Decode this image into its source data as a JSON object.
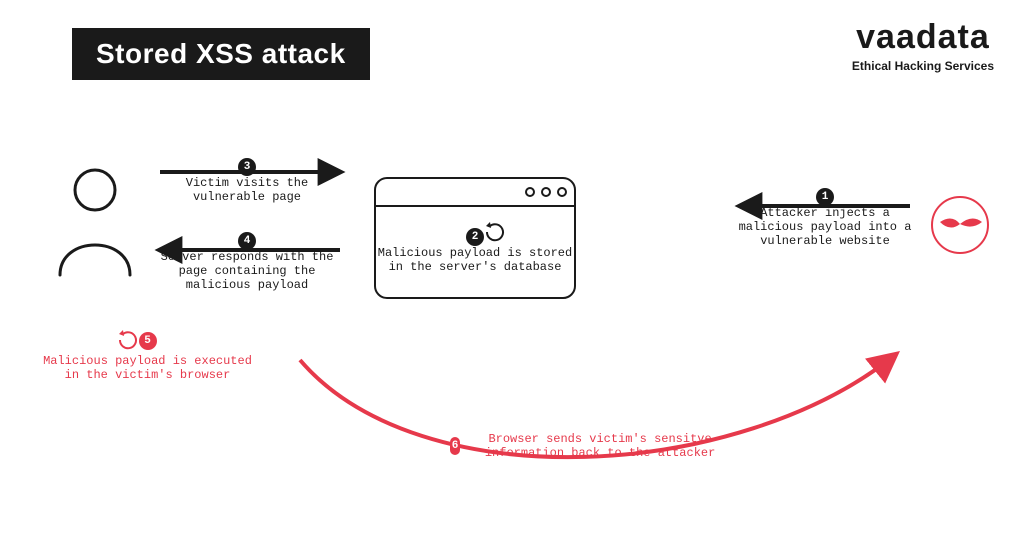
{
  "title": "Stored XSS attack",
  "brand": {
    "name": "vaadata",
    "tagline": "Ethical Hacking Services"
  },
  "steps": {
    "s1": {
      "num": "1",
      "text": "Attacker injects a malicious payload into a vulnerable website"
    },
    "s2": {
      "num": "2",
      "text": "Malicious payload is stored in the server's database"
    },
    "s3": {
      "num": "3",
      "text": "Victim visits the vulnerable page"
    },
    "s4": {
      "num": "4",
      "text": "Server responds with the page containing the malicious payload"
    },
    "s5": {
      "num": "5",
      "text": "Malicious payload is executed in the victim's browser"
    },
    "s6": {
      "num": "6",
      "text": "Browser sends victim's sensitve information back to the attacker"
    }
  },
  "actors": {
    "victim": "victim user",
    "server": "vulnerable website / server",
    "attacker": "attacker"
  },
  "colors": {
    "ink": "#1a1a1a",
    "accent": "#e6394b"
  }
}
